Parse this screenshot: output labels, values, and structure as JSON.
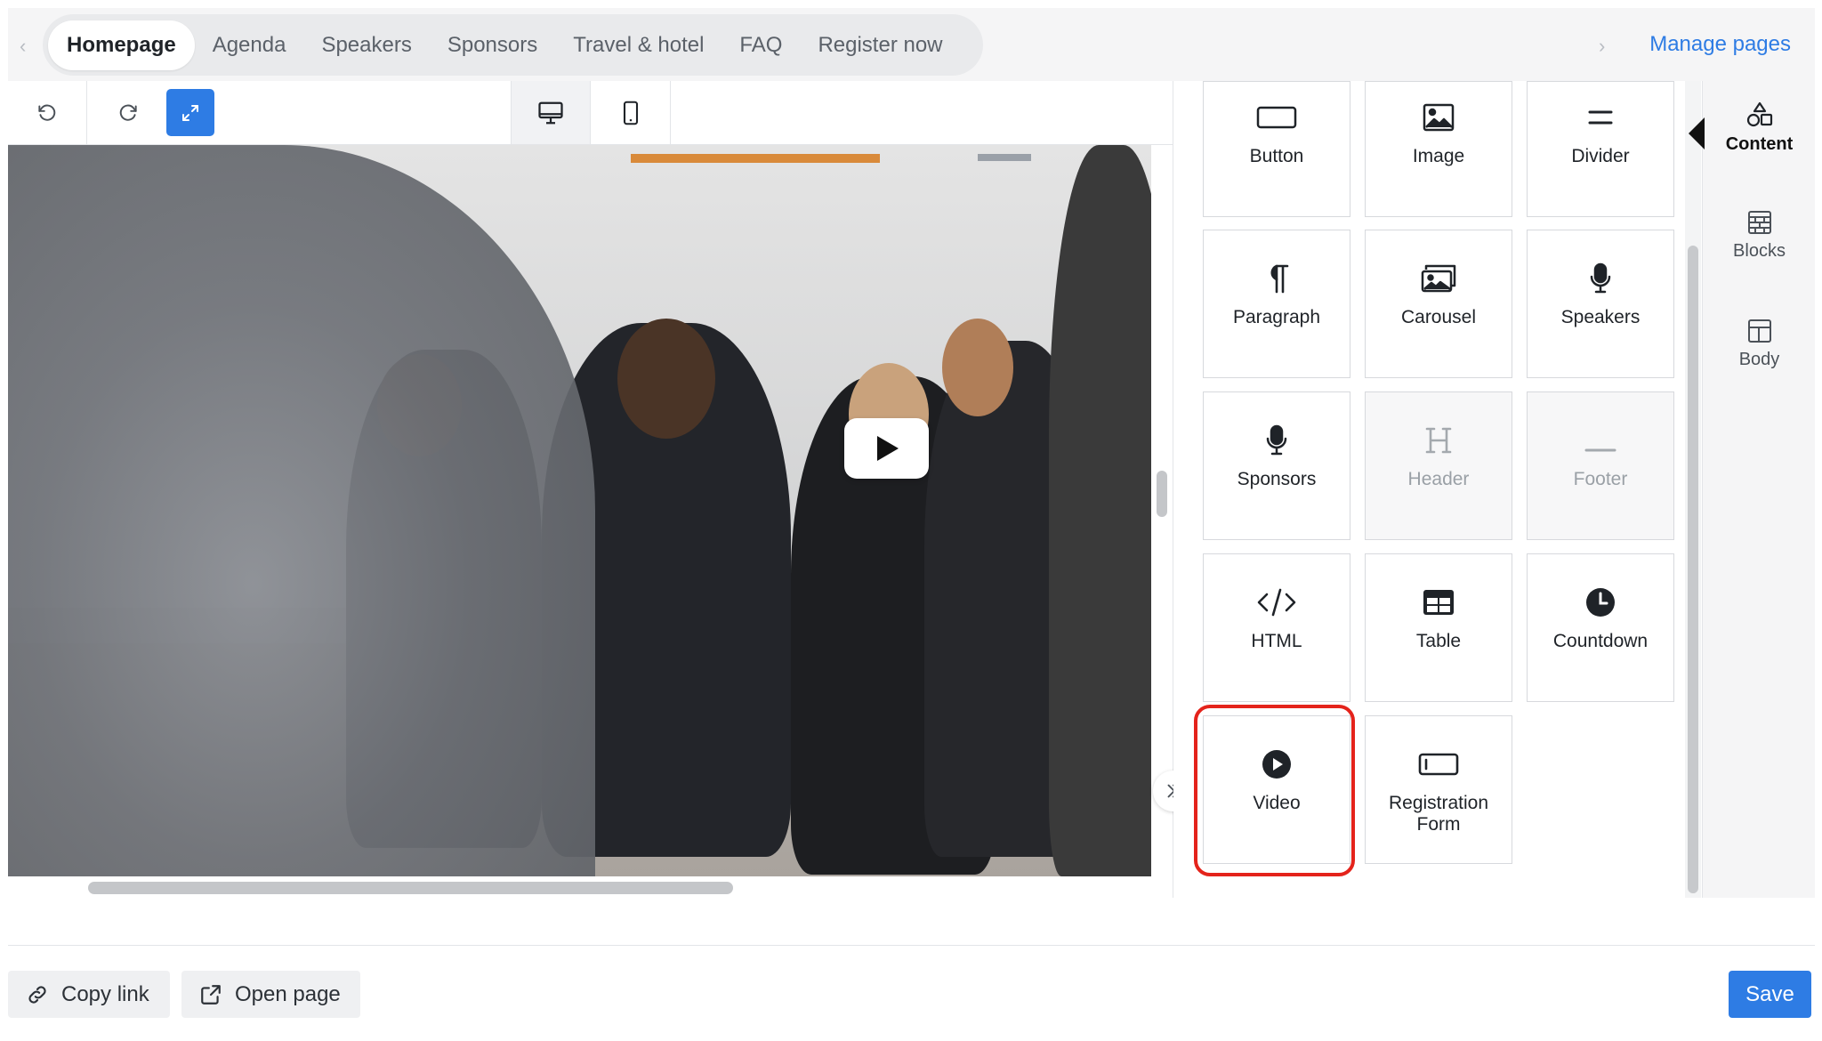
{
  "nav": {
    "tabs": [
      {
        "label": "Homepage",
        "active": true
      },
      {
        "label": "Agenda"
      },
      {
        "label": "Speakers"
      },
      {
        "label": "Sponsors"
      },
      {
        "label": "Travel & hotel"
      },
      {
        "label": "FAQ"
      },
      {
        "label": "Register now"
      }
    ],
    "manage_pages": "Manage pages"
  },
  "toolbar": {
    "icons": [
      "undo-icon",
      "redo-icon",
      "expand-icon",
      "desktop-icon",
      "mobile-icon"
    ]
  },
  "canvas": {
    "media": "video-preview",
    "play_icon": "play-icon"
  },
  "content_blocks": [
    {
      "label": "Button",
      "icon": "button-icon",
      "enabled": true
    },
    {
      "label": "Image",
      "icon": "image-icon",
      "enabled": true
    },
    {
      "label": "Divider",
      "icon": "divider-icon",
      "enabled": true
    },
    {
      "label": "Paragraph",
      "icon": "paragraph-icon",
      "enabled": true
    },
    {
      "label": "Carousel",
      "icon": "carousel-icon",
      "enabled": true
    },
    {
      "label": "Speakers",
      "icon": "microphone-icon",
      "enabled": true
    },
    {
      "label": "Sponsors",
      "icon": "microphone-icon",
      "enabled": true
    },
    {
      "label": "Header",
      "icon": "header-icon",
      "enabled": false
    },
    {
      "label": "Footer",
      "icon": "footer-icon",
      "enabled": false
    },
    {
      "label": "HTML",
      "icon": "code-icon",
      "enabled": true
    },
    {
      "label": "Table",
      "icon": "table-icon",
      "enabled": true
    },
    {
      "label": "Countdown",
      "icon": "clock-icon",
      "enabled": true
    },
    {
      "label": "Video",
      "icon": "video-icon",
      "enabled": true,
      "highlighted": true
    },
    {
      "label": "Registration Form",
      "icon": "form-icon",
      "enabled": true
    }
  ],
  "rail": [
    {
      "label": "Content",
      "icon": "shapes-icon",
      "active": true
    },
    {
      "label": "Blocks",
      "icon": "blocks-icon"
    },
    {
      "label": "Body",
      "icon": "body-layout-icon"
    }
  ],
  "footer": {
    "copy_link": "Copy link",
    "open_page": "Open page",
    "save": "Save"
  },
  "colors": {
    "accent": "#2e7ce4",
    "highlight": "#e4231b"
  }
}
